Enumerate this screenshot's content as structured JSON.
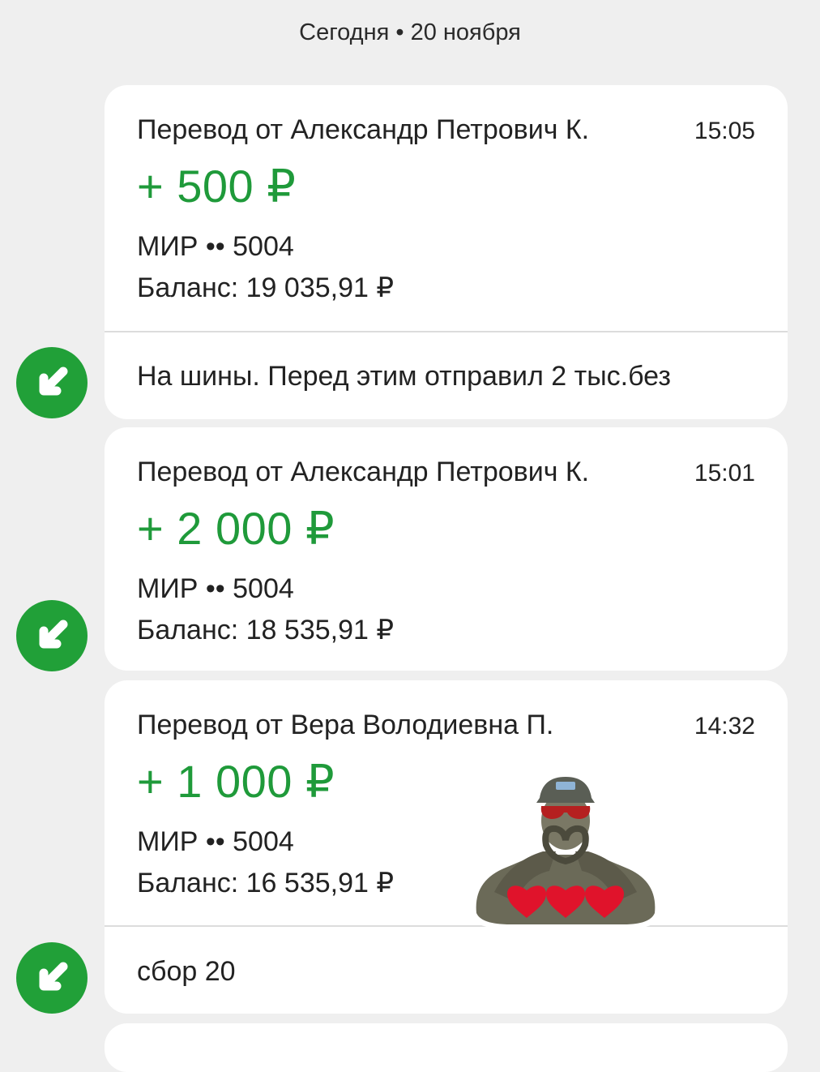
{
  "date_header": "Сегодня • 20 ноября",
  "transactions": [
    {
      "title": "Перевод от Александр Петрович К.",
      "time": "15:05",
      "amount": "+ 500 ₽",
      "card": "МИР •• 5004",
      "balance": "Баланс: 19 035,91 ₽",
      "comment": "На шины. Перед этим отправил  2 тыс.без"
    },
    {
      "title": "Перевод от Александр Петрович К.",
      "time": "15:01",
      "amount": "+ 2 000 ₽",
      "card": "МИР •• 5004",
      "balance": "Баланс: 18 535,91 ₽"
    },
    {
      "title": "Перевод от Вера Володиевна П.",
      "time": "14:32",
      "amount": "+ 1 000 ₽",
      "card": "МИР •• 5004",
      "balance": "Баланс: 16 535,91 ₽",
      "comment": "сбор 20"
    }
  ],
  "colors": {
    "accent_green": "#21a038",
    "amount_green": "#1f9a3a",
    "background": "#efefef"
  },
  "icons": {
    "incoming": "arrow-down-left-icon",
    "sticker": "soldier-heart-sticker"
  }
}
